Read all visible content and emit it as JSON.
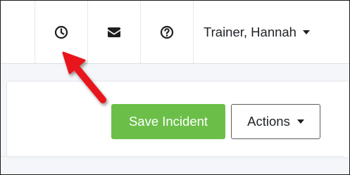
{
  "navbar": {
    "icons": [
      {
        "name": "history-clock-icon",
        "tooltip": ""
      },
      {
        "name": "envelope-icon",
        "tooltip": ""
      },
      {
        "name": "help-question-icon",
        "tooltip": ""
      }
    ],
    "user_name": "Trainer, Hannah"
  },
  "toolbar": {
    "save_label": "Save Incident",
    "actions_label": "Actions"
  },
  "colors": {
    "save_button": "#6bbf49",
    "annotation_arrow": "#e8151b",
    "page_background": "#f4f6f9"
  }
}
